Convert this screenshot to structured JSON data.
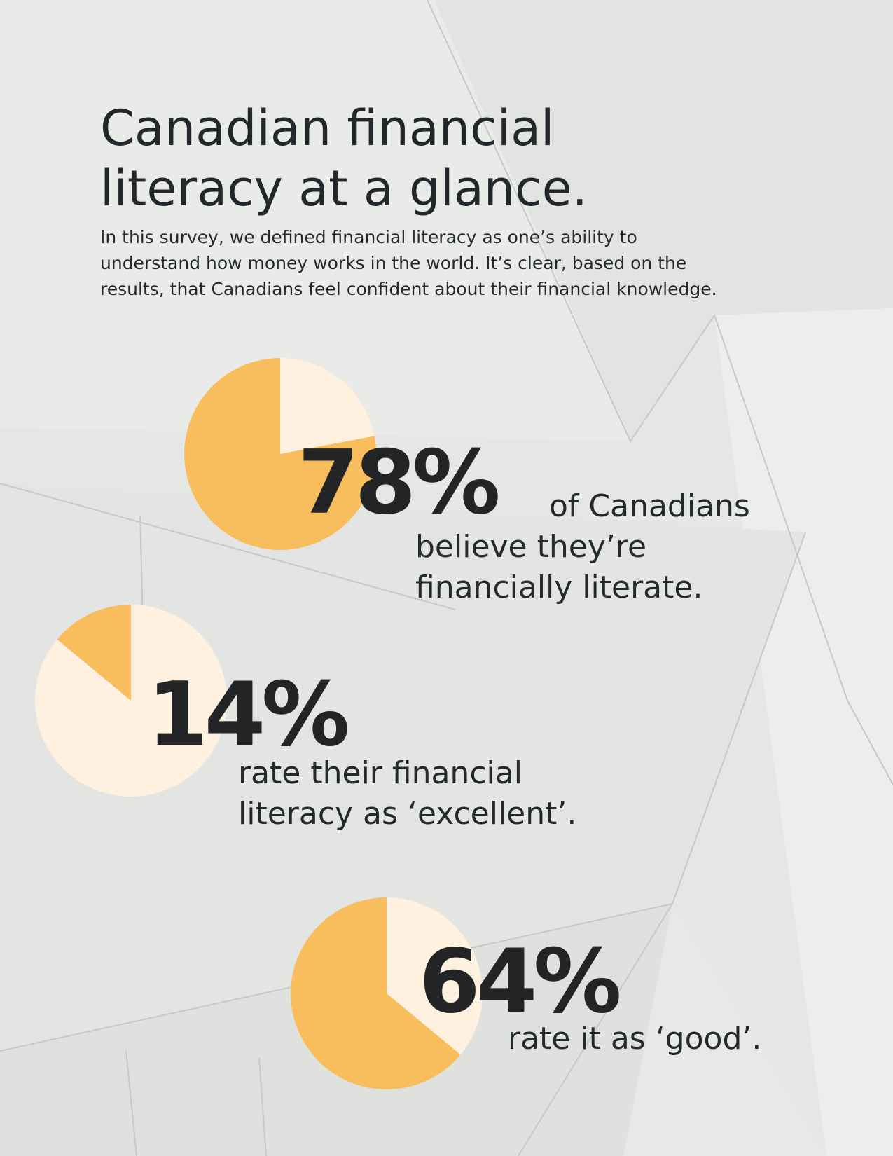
{
  "title_line1": "Canadian financial",
  "title_line2": "literacy at a glance.",
  "intro_lines": [
    "In this survey, we defined financial literacy as one’s ability to",
    "understand how money works in the world. It’s clear, based on the",
    "results, that Canadians feel confident about their financial knowledge."
  ],
  "colors": {
    "primary": "#F8BE5E",
    "secondary": "#FEF1E0",
    "text": "#222426",
    "background": "#E6E8E6"
  },
  "stats": [
    {
      "value_text": "78%",
      "caption_lines": [
        "of Canadians",
        "believe they’re",
        "financially literate."
      ]
    },
    {
      "value_text": "14%",
      "caption_lines": [
        "rate their financial",
        "literacy as ‘excellent’."
      ]
    },
    {
      "value_text": "64%",
      "caption_lines": [
        "rate it as ‘good’."
      ]
    }
  ],
  "chart_data": [
    {
      "type": "pie",
      "slices": [
        {
          "value": 78,
          "color": "#F8BE5E"
        },
        {
          "value": 22,
          "color": "#FEF1E0"
        }
      ]
    },
    {
      "type": "pie",
      "slices": [
        {
          "value": 14,
          "color": "#F8BE5E"
        },
        {
          "value": 86,
          "color": "#FEF1E0"
        }
      ]
    },
    {
      "type": "pie",
      "slices": [
        {
          "value": 64,
          "color": "#F8BE5E"
        },
        {
          "value": 36,
          "color": "#FEF1E0"
        }
      ]
    }
  ]
}
